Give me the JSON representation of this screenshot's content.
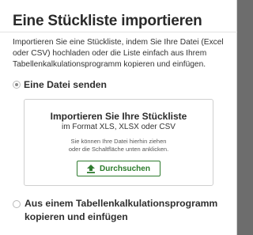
{
  "dialog": {
    "title": "Eine Stückliste importieren",
    "intro": "Importieren Sie eine Stückliste, indem Sie Ihre Datei (Excel oder CSV) hochladen oder die Liste einfach aus Ihrem Tabellenkalkulationsprogramm kopieren und einfügen."
  },
  "options": {
    "send_file_label": "Eine Datei senden",
    "spreadsheet_label": "Aus einem Tabellenkalkulationsprogramm kopieren und einfügen"
  },
  "upload": {
    "title": "Importieren Sie Ihre Stückliste",
    "formats": "im Format XLS, XLSX oder CSV",
    "hint_line1": "Sie können Ihre Datei hierhin ziehen",
    "hint_line2": "oder die Schaltfläche unten anklicken.",
    "button_label": "Durchsuchen",
    "button_icon": "upload-icon"
  },
  "colors": {
    "accent": "#2f7b2f",
    "title": "#2a2a2a"
  }
}
